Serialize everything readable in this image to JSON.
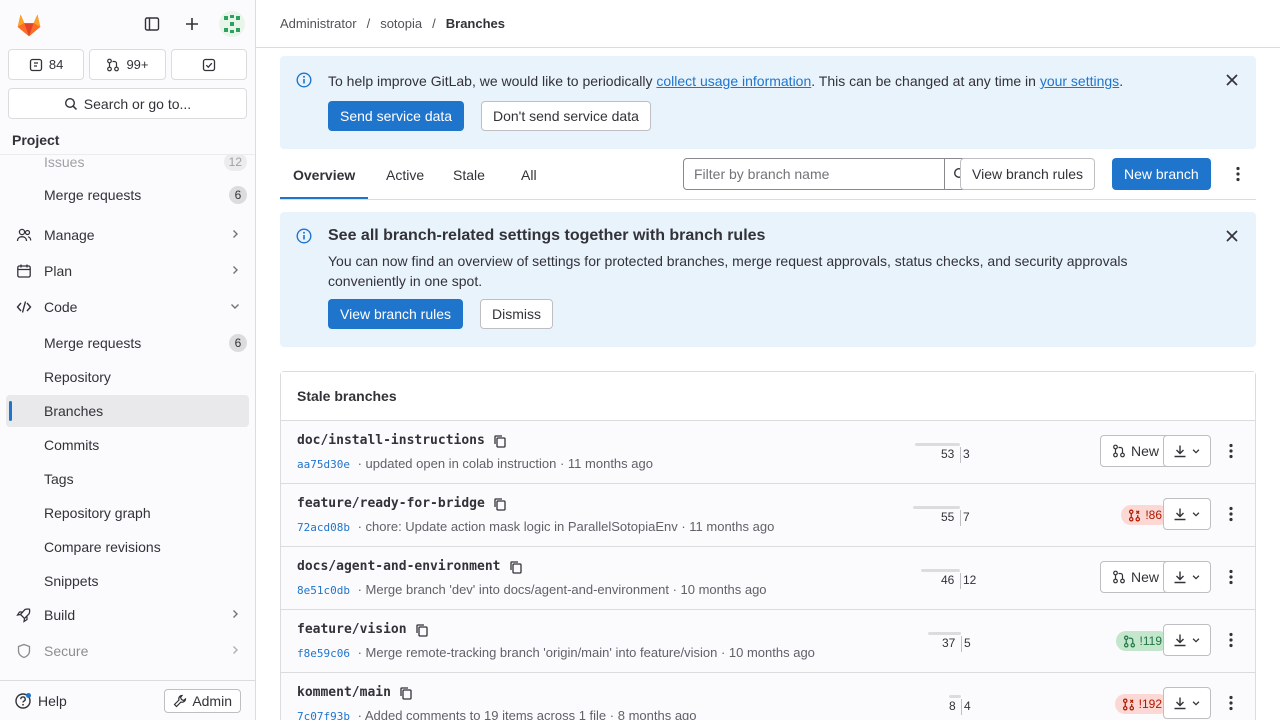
{
  "sidebar": {
    "issues_count": "84",
    "mr_count": "99+",
    "search_label": "Search or go to...",
    "project_label": "Project",
    "partial_item": {
      "label": "Issues",
      "count": "12"
    },
    "items": [
      {
        "label": "Merge requests",
        "count": "6"
      },
      {
        "label": "Manage"
      },
      {
        "label": "Plan"
      },
      {
        "label": "Code"
      },
      {
        "label": "Merge requests",
        "count": "6"
      },
      {
        "label": "Repository"
      },
      {
        "label": "Branches"
      },
      {
        "label": "Commits"
      },
      {
        "label": "Tags"
      },
      {
        "label": "Repository graph"
      },
      {
        "label": "Compare revisions"
      },
      {
        "label": "Snippets"
      },
      {
        "label": "Build"
      },
      {
        "label": "Secure"
      }
    ],
    "help_label": "Help",
    "admin_label": "Admin"
  },
  "breadcrumb": {
    "items": [
      "Administrator",
      "sotopia"
    ],
    "current": "Branches"
  },
  "usage_alert": {
    "text_before": "To help improve GitLab, we would like to periodically ",
    "link1": "collect usage information",
    "text_middle": ". This can be changed at any time in ",
    "link2": "your settings",
    "text_after": ".",
    "send_label": "Send service data",
    "dont_send_label": "Don't send service data"
  },
  "tabs": [
    "Overview",
    "Active",
    "Stale",
    "All"
  ],
  "filter": {
    "placeholder": "Filter by branch name"
  },
  "actions": {
    "view_rules": "View branch rules",
    "new_branch": "New branch"
  },
  "rules_alert": {
    "title": "See all branch-related settings together with branch rules",
    "body": "You can now find an overview of settings for protected branches, merge request approvals, status checks, and security approvals conveniently in one spot.",
    "view_label": "View branch rules",
    "dismiss_label": "Dismiss"
  },
  "stale": {
    "title": "Stale branches",
    "new_label": "New",
    "branches": [
      {
        "name": "doc/install-instructions",
        "sha": "aa75d30e",
        "message": "updated open in colab instruction",
        "time": "11 months ago",
        "behind": "53",
        "ahead": "3",
        "mr": ""
      },
      {
        "name": "feature/ready-for-bridge",
        "sha": "72acd08b",
        "message": "chore: Update action mask logic in ParallelSotopiaEnv",
        "time": "11 months ago",
        "behind": "55",
        "ahead": "7",
        "mr": "!86",
        "mr_state": "closed"
      },
      {
        "name": "docs/agent-and-environment",
        "sha": "8e51c0db",
        "message": "Merge branch 'dev' into docs/agent-and-environment",
        "time": "10 months ago",
        "behind": "46",
        "ahead": "12",
        "mr": ""
      },
      {
        "name": "feature/vision",
        "sha": "f8e59c06",
        "message": "Merge remote-tracking branch 'origin/main' into feature/vision",
        "time": "10 months ago",
        "behind": "37",
        "ahead": "5",
        "mr": "!119",
        "mr_state": "open"
      },
      {
        "name": "komment/main",
        "sha": "7c07f93b",
        "message": "Added comments to 19 items across 1 file",
        "time": "8 months ago",
        "behind": "8",
        "ahead": "4",
        "mr": "!192",
        "mr_state": "closed"
      }
    ]
  },
  "colors": {
    "primary": "#1f75cb",
    "alert_bg": "#e9f3fc",
    "closed": "#ae1800",
    "open": "#217645"
  }
}
